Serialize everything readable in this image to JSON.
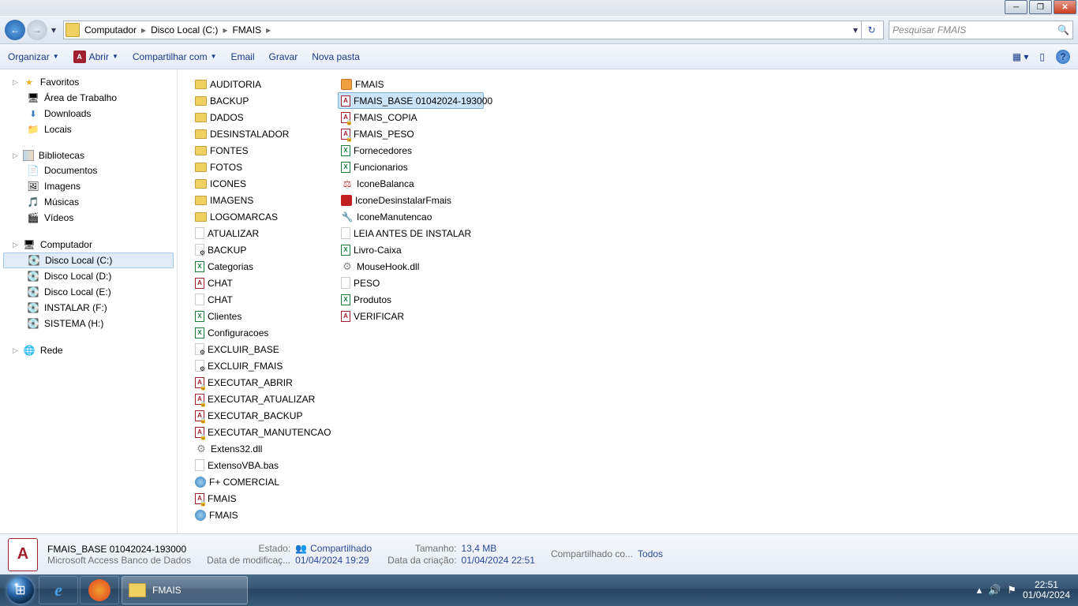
{
  "breadcrumb": {
    "p1": "Computador",
    "p2": "Disco Local (C:)",
    "p3": "FMAIS"
  },
  "search": {
    "placeholder": "Pesquisar FMAIS"
  },
  "toolbar": {
    "organize": "Organizar",
    "open": "Abrir",
    "share": "Compartilhar com",
    "email": "Email",
    "burn": "Gravar",
    "newfolder": "Nova pasta"
  },
  "tree": {
    "favorites": "Favoritos",
    "desktop": "Área de Trabalho",
    "downloads": "Downloads",
    "places": "Locais",
    "libraries": "Bibliotecas",
    "documents": "Documentos",
    "pictures": "Imagens",
    "music": "Músicas",
    "videos": "Vídeos",
    "computer": "Computador",
    "diskC": "Disco Local (C:)",
    "diskD": "Disco Local (D:)",
    "diskE": "Disco Local (E:)",
    "diskF": "INSTALAR (F:)",
    "diskH": "SISTEMA (H:)",
    "network": "Rede"
  },
  "col1": {
    "f0": "AUDITORIA",
    "f1": "BACKUP",
    "f2": "DADOS",
    "f3": "DESINSTALADOR",
    "f4": "FONTES",
    "f5": "FOTOS",
    "f6": "ICONES",
    "f7": "IMAGENS",
    "f8": "LOGOMARCAS",
    "f9": "ATUALIZAR",
    "f10": "BACKUP",
    "f11": "Categorias",
    "f12": "CHAT",
    "f13": "CHAT",
    "f14": "Clientes",
    "f15": "Configuracoes",
    "f16": "EXCLUIR_BASE",
    "f17": "EXCLUIR_FMAIS",
    "f18": "EXECUTAR_ABRIR",
    "f19": "EXECUTAR_ATUALIZAR",
    "f20": "EXECUTAR_BACKUP",
    "f21": "EXECUTAR_MANUTENCAO",
    "f22": "Extens32.dll",
    "f23": "ExtensoVBA.bas",
    "f24": "F+ COMERCIAL",
    "f25": "FMAIS",
    "f26": "FMAIS"
  },
  "col2": {
    "f0": "FMAIS",
    "f1": "FMAIS_BASE 01042024-193000",
    "f2": "FMAIS_COPIA",
    "f3": "FMAIS_PESO",
    "f4": "Fornecedores",
    "f5": "Funcionarios",
    "f6": "IconeBalanca",
    "f7": "IconeDesinstalarFmais",
    "f8": "IconeManutencao",
    "f9": "LEIA ANTES DE INSTALAR",
    "f10": "Livro-Caixa",
    "f11": "MouseHook.dll",
    "f12": "PESO",
    "f13": "Produtos",
    "f14": "VERIFICAR"
  },
  "status": {
    "name": "FMAIS_BASE 01042024-193000",
    "type": "Microsoft Access Banco de Dados",
    "state_lbl": "Estado:",
    "state_val": "Compartilhado",
    "mod_lbl": "Data de modificaç...",
    "mod_val": "01/04/2024 19:29",
    "size_lbl": "Tamanho:",
    "size_val": "13,4 MB",
    "crt_lbl": "Data da criação:",
    "crt_val": "01/04/2024 22:51",
    "sharedwith_lbl": "Compartilhado co...",
    "sharedwith_val": "Todos"
  },
  "taskbar": {
    "task": "FMAIS",
    "time": "22:51",
    "date": "01/04/2024"
  }
}
